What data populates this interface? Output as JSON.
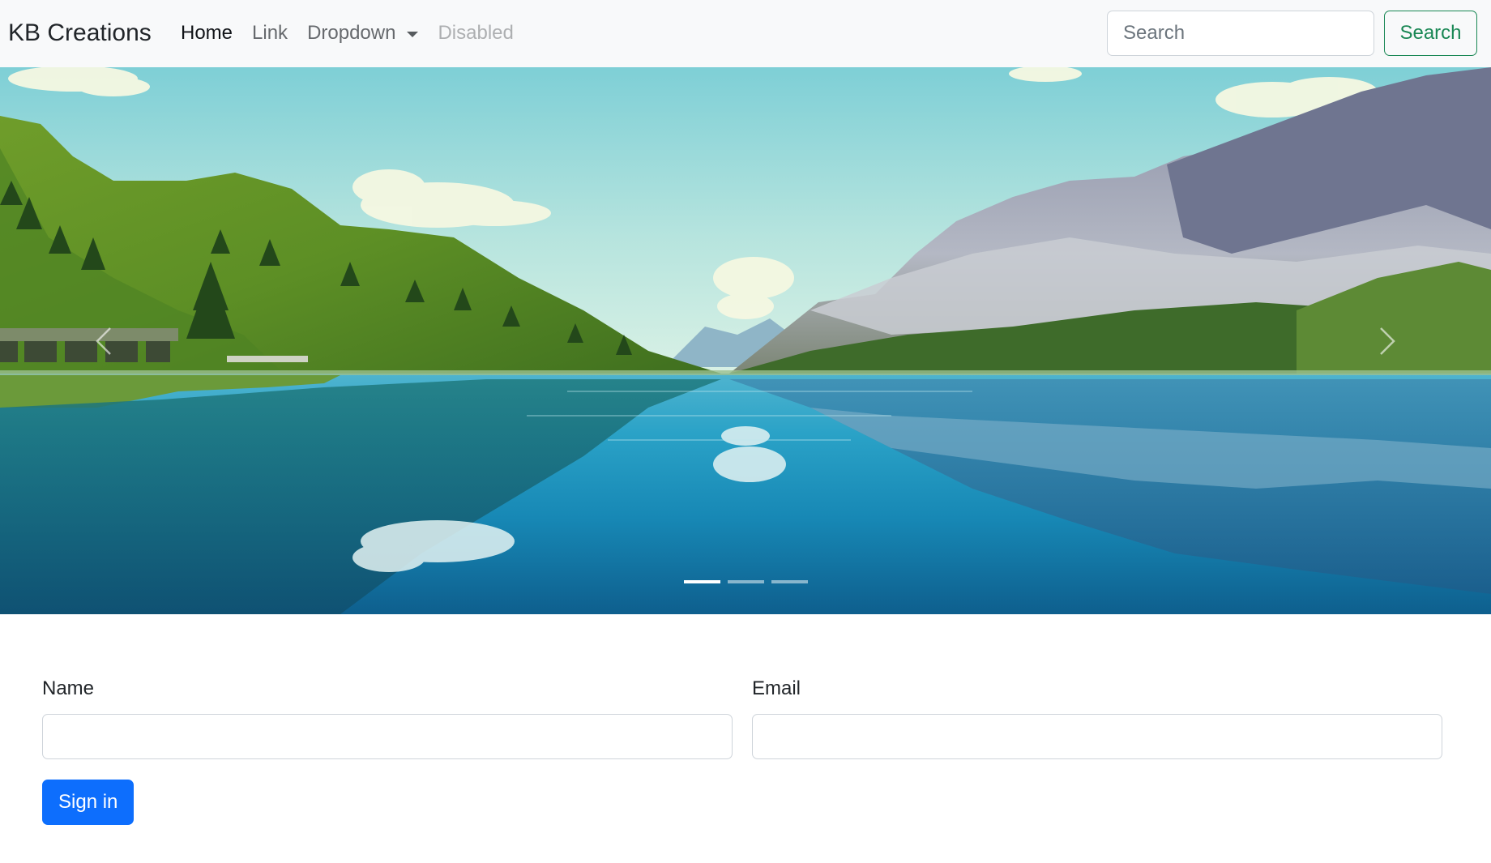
{
  "navbar": {
    "brand": "KB Creations",
    "links": [
      {
        "label": "Home",
        "state": "active"
      },
      {
        "label": "Link",
        "state": "normal"
      },
      {
        "label": "Dropdown",
        "state": "dropdown"
      },
      {
        "label": "Disabled",
        "state": "disabled"
      }
    ],
    "search": {
      "placeholder": "Search",
      "button_label": "Search"
    }
  },
  "carousel": {
    "slide_count": 3,
    "active_index": 0,
    "controls": [
      "previous",
      "next"
    ],
    "image_subject": "mountain lake landscape"
  },
  "form": {
    "name_label": "Name",
    "name_value": "",
    "email_label": "Email",
    "email_value": "",
    "submit_label": "Sign in"
  },
  "colors": {
    "navbar_bg": "#f8f9fa",
    "primary": "#0d6efd",
    "success": "#198754",
    "input_border": "#ced4da"
  }
}
